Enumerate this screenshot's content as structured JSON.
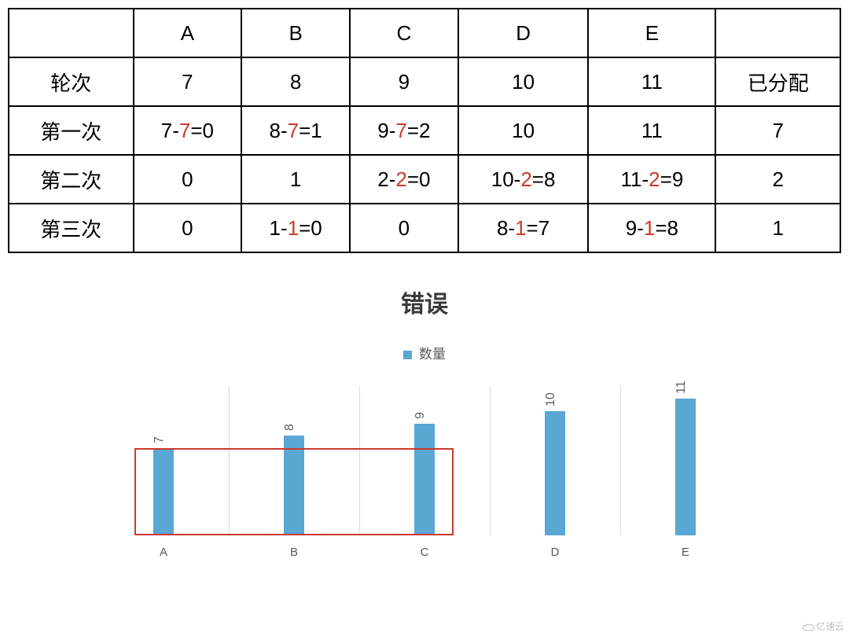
{
  "table": {
    "headers": [
      "",
      "A",
      "B",
      "C",
      "D",
      "E",
      ""
    ],
    "rows": [
      {
        "label": "轮次",
        "cells": [
          [
            {
              "t": "7"
            }
          ],
          [
            {
              "t": "8"
            }
          ],
          [
            {
              "t": "9"
            }
          ],
          [
            {
              "t": "10"
            }
          ],
          [
            {
              "t": "11"
            }
          ],
          [
            {
              "t": "已分配"
            }
          ]
        ]
      },
      {
        "label": "第一次",
        "cells": [
          [
            {
              "t": "7-"
            },
            {
              "t": "7",
              "hl": true
            },
            {
              "t": "=0"
            }
          ],
          [
            {
              "t": "8-"
            },
            {
              "t": "7",
              "hl": true
            },
            {
              "t": "=1"
            }
          ],
          [
            {
              "t": "9-"
            },
            {
              "t": "7",
              "hl": true
            },
            {
              "t": "=2"
            }
          ],
          [
            {
              "t": "10"
            }
          ],
          [
            {
              "t": "11"
            }
          ],
          [
            {
              "t": "7"
            }
          ]
        ]
      },
      {
        "label": "第二次",
        "cells": [
          [
            {
              "t": "0"
            }
          ],
          [
            {
              "t": "1"
            }
          ],
          [
            {
              "t": "2-"
            },
            {
              "t": "2",
              "hl": true
            },
            {
              "t": "=0"
            }
          ],
          [
            {
              "t": "10-"
            },
            {
              "t": "2",
              "hl": true
            },
            {
              "t": "=8"
            }
          ],
          [
            {
              "t": "11-"
            },
            {
              "t": "2",
              "hl": true
            },
            {
              "t": "=9"
            }
          ],
          [
            {
              "t": "2"
            }
          ]
        ]
      },
      {
        "label": "第三次",
        "cells": [
          [
            {
              "t": "0"
            }
          ],
          [
            {
              "t": "1-"
            },
            {
              "t": "1",
              "hl": true
            },
            {
              "t": "=0"
            }
          ],
          [
            {
              "t": "0"
            }
          ],
          [
            {
              "t": "8-"
            },
            {
              "t": "1",
              "hl": true
            },
            {
              "t": "=7"
            }
          ],
          [
            {
              "t": "9-"
            },
            {
              "t": "1",
              "hl": true
            },
            {
              "t": "=8"
            }
          ],
          [
            {
              "t": "1"
            }
          ]
        ]
      }
    ]
  },
  "chart_data": {
    "type": "bar",
    "title": "错误",
    "legend": "数量",
    "categories": [
      "A",
      "B",
      "C",
      "D",
      "E"
    ],
    "values": [
      7,
      8,
      9,
      10,
      11
    ],
    "ylim": [
      0,
      12
    ],
    "highlight_range": {
      "from": "A",
      "to": "C",
      "level": 7
    },
    "bar_color": "#5aa7d4",
    "highlight_color": "#cc3b2b"
  },
  "watermark": "亿速云"
}
